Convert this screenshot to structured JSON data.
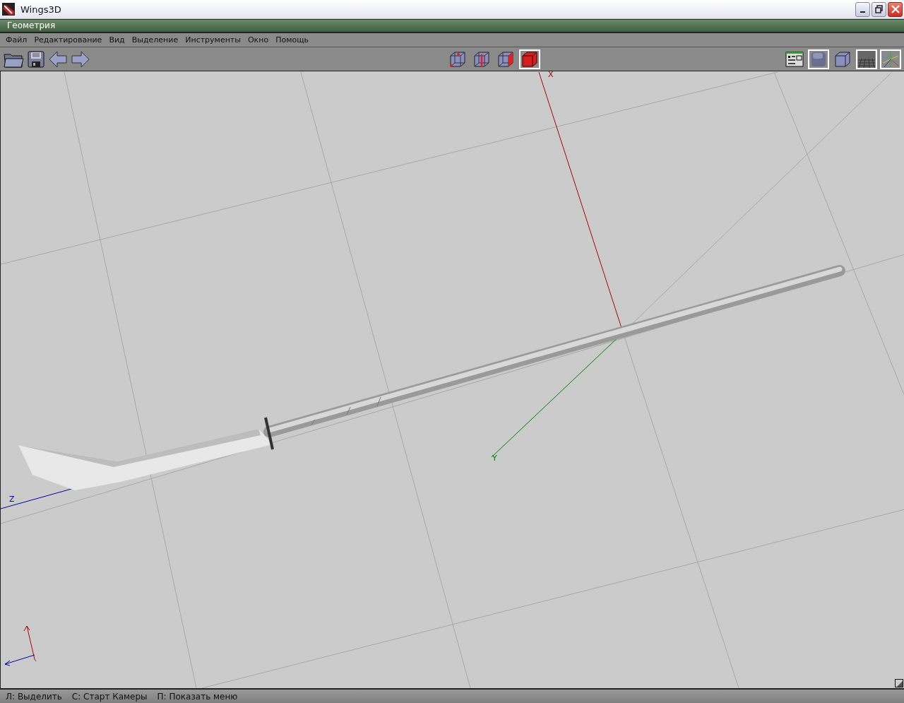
{
  "window": {
    "title": "Wings3D"
  },
  "geometry_window": {
    "title": "Геометрия"
  },
  "menu": [
    "Файл",
    "Редактирование",
    "Вид",
    "Выделение",
    "Инструменты",
    "Окно",
    "Помощь"
  ],
  "selection_modes": [
    {
      "kind": "vertex",
      "selected": false
    },
    {
      "kind": "edge",
      "selected": false
    },
    {
      "kind": "face",
      "selected": false
    },
    {
      "kind": "body",
      "selected": true
    }
  ],
  "view_buttons": [
    {
      "kind": "info",
      "on": false
    },
    {
      "kind": "smooth",
      "on": true
    },
    {
      "kind": "flat",
      "on": false
    },
    {
      "kind": "groundplane",
      "on": true
    },
    {
      "kind": "axes",
      "on": true
    }
  ],
  "axis_labels": [
    {
      "kind": "x",
      "text": "X"
    },
    {
      "kind": "y",
      "text": "Y"
    },
    {
      "kind": "z",
      "text": "Z"
    }
  ],
  "status_bar": [
    "Л: Выделить",
    "С: Старт Камеры",
    "П: Показать меню"
  ]
}
